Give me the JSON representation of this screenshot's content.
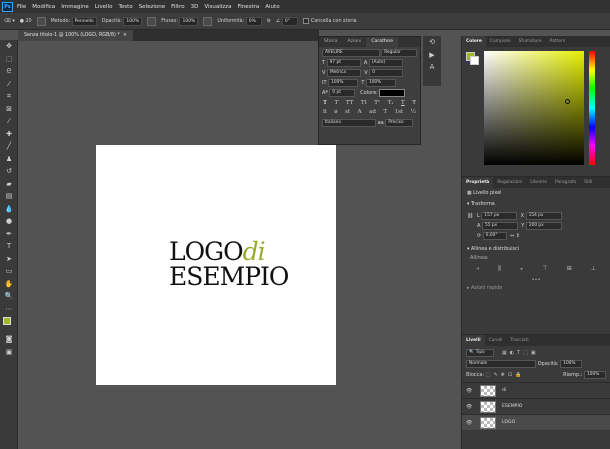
{
  "menu": [
    "File",
    "Modifica",
    "Immagine",
    "Livello",
    "Testo",
    "Selezione",
    "Filtro",
    "3D",
    "Visualizza",
    "Finestra",
    "Aiuto"
  ],
  "logo_text": "Ps",
  "options": {
    "size": "20",
    "method_label": "Metodo:",
    "method_value": "Pennello",
    "opacity_label": "Opacità:",
    "opacity_value": "100%",
    "flow_label": "Flusso:",
    "flow_value": "100%",
    "smoothing_label": "Uniformità:",
    "smoothing_value": "0%",
    "angle_value": "0°",
    "history_label": "Cancella con storia"
  },
  "document_tab": "Senza titolo-1 @ 100% (LOGO, RGB/8) *",
  "artwork": {
    "line1_a": "LOGO",
    "line1_b": "di",
    "line2": "ESEMPIO"
  },
  "character_panel": {
    "tabs": [
      "Storia",
      "Azioni",
      "Carattere"
    ],
    "font_family": "AVELIRE",
    "font_style": "Regular",
    "size": "97 pt",
    "leading": "(Auto)",
    "kerning": "Metrica",
    "tracking": "0",
    "vscale": "100%",
    "hscale": "100%",
    "baseline": "0 pt",
    "color_label": "Colore:",
    "glyphs": [
      "T",
      "T",
      "TT",
      "Tt",
      "T¹",
      "T₁",
      "T",
      "Ŧ"
    ],
    "glyphs2": [
      "fi",
      "ø",
      "st",
      "A",
      "ad",
      "T",
      "1st",
      "½"
    ],
    "language": "Italiano",
    "aa": "Preciso"
  },
  "right_tabs": [
    "Colore",
    "Campioni",
    "Sfumature",
    "Pattern"
  ],
  "props_tabs": [
    "Proprietà",
    "Regolazioni",
    "Librerie",
    "Paragrafo",
    "Stili"
  ],
  "props": {
    "layer_kind": "Livello pixel",
    "transform_title": "Trasforma",
    "w_label": "L",
    "w_value": "157 px",
    "x_label": "X",
    "x_value": "154 px",
    "h_label": "A",
    "h_value": "55 px",
    "y_label": "Y",
    "y_value": "200 px",
    "angle": "0,00°",
    "align_title": "Allinea e distribuisci",
    "align_sub": "Allinea:",
    "quick_actions": "Azioni rapide"
  },
  "layers_tabs": [
    "Livelli",
    "Canali",
    "Tracciati"
  ],
  "layers": {
    "filter_kind": "Tipo",
    "blend": "Normale",
    "opacity_label": "Opacità:",
    "opacity_value": "100%",
    "lock_label": "Blocca:",
    "fill_label": "Riemp.:",
    "fill_value": "100%",
    "items": [
      "di",
      "ESEMPIO",
      "LOGO"
    ]
  },
  "colors": {
    "accent": "#9aab2b",
    "fg_swatch": "#a5b52a"
  }
}
